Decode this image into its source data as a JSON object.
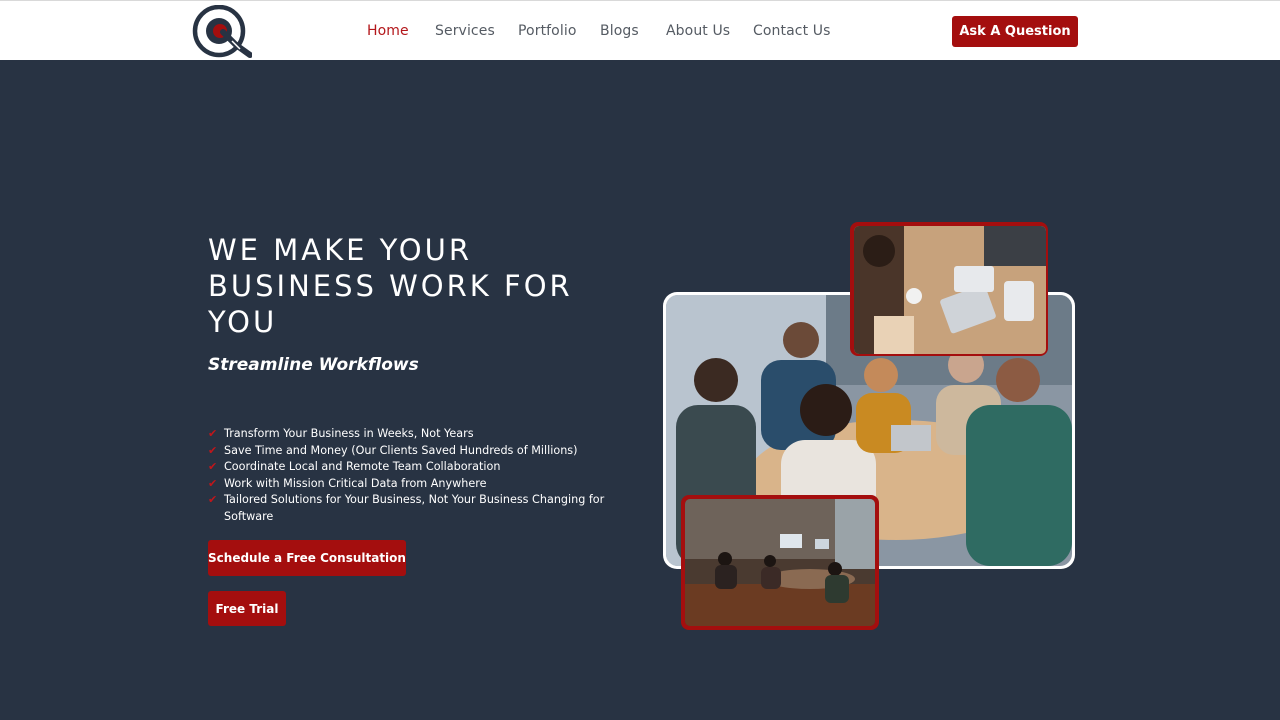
{
  "nav": {
    "items": [
      {
        "label": "Home",
        "active": true
      },
      {
        "label": "Services",
        "active": false
      },
      {
        "label": "Portfolio",
        "active": false
      },
      {
        "label": "Blogs",
        "active": false
      },
      {
        "label": "About Us",
        "active": false
      },
      {
        "label": "Contact Us",
        "active": false
      }
    ],
    "cta_label": "Ask A Question"
  },
  "hero": {
    "title": "WE MAKE YOUR BUSINESS WORK FOR YOU",
    "subtitle": "Streamline Workflows",
    "bullets": [
      "Transform Your Business in Weeks, Not Years",
      "Save Time and Money (Our Clients Saved Hundreds of Millions)",
      "Coordinate Local and Remote Team Collaboration",
      "Work with Mission Critical Data from Anywhere",
      "Tailored Solutions for Your Business, Not Your Business Changing for Software"
    ],
    "primary_button": "Schedule a Free Consultation",
    "secondary_button": "Free Trial"
  },
  "images": {
    "main": "team-meeting-photo",
    "top": "laptops-on-table-photo",
    "bottom": "office-room-photo"
  },
  "colors": {
    "accent": "#a40e0e",
    "background": "#283343",
    "header": "#ffffff"
  }
}
